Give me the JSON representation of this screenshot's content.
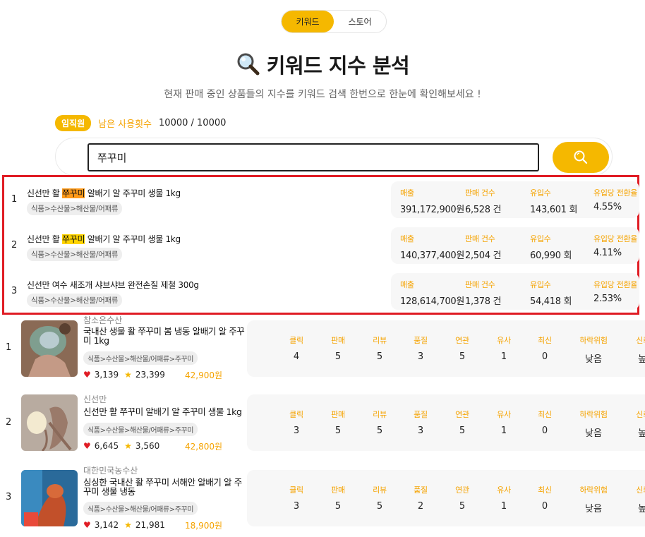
{
  "tabs": [
    {
      "label": "키워드",
      "active": true
    },
    {
      "label": "스토어",
      "active": false
    }
  ],
  "page_title": "키워드 지수 분석",
  "title_icon": "magnifier-icon",
  "subtitle": "현재 판매 중인 상품들의 지수를 키워드 검색 한번으로 한눈에 확인해보세요 !",
  "usage": {
    "badge": "임직원",
    "label": "남은 사용횟수",
    "value": "10000 / 10000"
  },
  "search": {
    "value": "쭈꾸미",
    "button_icon": "search-icon"
  },
  "colors": {
    "accent": "#f5b800",
    "label": "#f5a300",
    "highlight_box": "#e01c24"
  },
  "keyword_results": {
    "stat_labels": [
      "매출",
      "판매 건수",
      "유입수",
      "유입당 전환율"
    ],
    "rows": [
      {
        "rank": "1",
        "name_pre": "신선만 활 ",
        "name_hl": "쭈꾸미",
        "name_post": " 알배기 알 주꾸미 생물 1kg",
        "category": "식품>수산물>해산물/어패류",
        "sales": "391,172,900원",
        "count": "6,528 건",
        "visits": "143,601 회",
        "conversion": "4.55%"
      },
      {
        "rank": "2",
        "name_pre": "신선만 활 ",
        "name_hl": "쭈꾸미",
        "name_post": " 알배기 알 주꾸미 생물 1kg",
        "category": "식품>수산물>해산물/어패류",
        "sales": "140,377,400원",
        "count": "2,504 건",
        "visits": "60,990 회",
        "conversion": "4.11%"
      },
      {
        "rank": "3",
        "name_pre": "신선만 여수 새조개 샤브샤브 완전손질 제철 300g",
        "name_hl": "",
        "name_post": "",
        "category": "식품>수산물>해산물/어패류",
        "sales": "128,614,700원",
        "count": "1,378 건",
        "visits": "54,418 회",
        "conversion": "2.53%"
      }
    ]
  },
  "products": {
    "stat_labels": [
      "클릭",
      "판매",
      "리뷰",
      "품질",
      "연관",
      "유사",
      "최신",
      "하락위험",
      "신뢰도"
    ],
    "rows": [
      {
        "rank": "1",
        "store": "참소은수산",
        "title": "국내산 생물 활 쭈꾸미 봄 냉동 알배기 알 주꾸미 1kg",
        "category": "식품>수산물>해산물/어패류>주꾸미",
        "likes": "3,139",
        "rating": "23,399",
        "price": "42,900원",
        "stats": [
          "4",
          "5",
          "5",
          "3",
          "5",
          "1",
          "0",
          "낮음",
          "높음"
        ]
      },
      {
        "rank": "2",
        "store": "신선만",
        "title": "신선만 활 쭈꾸미 알배기 알 주꾸미 생물 1kg",
        "category": "식품>수산물>해산물/어패류>주꾸미",
        "likes": "6,645",
        "rating": "3,560",
        "price": "42,800원",
        "stats": [
          "3",
          "5",
          "5",
          "3",
          "5",
          "1",
          "0",
          "낮음",
          "높음"
        ]
      },
      {
        "rank": "3",
        "store": "대한민국농수산",
        "title": "싱싱한 국내산 활 쭈꾸미 서해안 알배기 알 주꾸미 생물 냉동",
        "category": "식품>수산물>해산물/어패류>주꾸미",
        "likes": "3,142",
        "rating": "21,981",
        "price": "18,900원",
        "stats": [
          "3",
          "5",
          "5",
          "2",
          "5",
          "1",
          "0",
          "낮음",
          "높음"
        ]
      }
    ]
  }
}
